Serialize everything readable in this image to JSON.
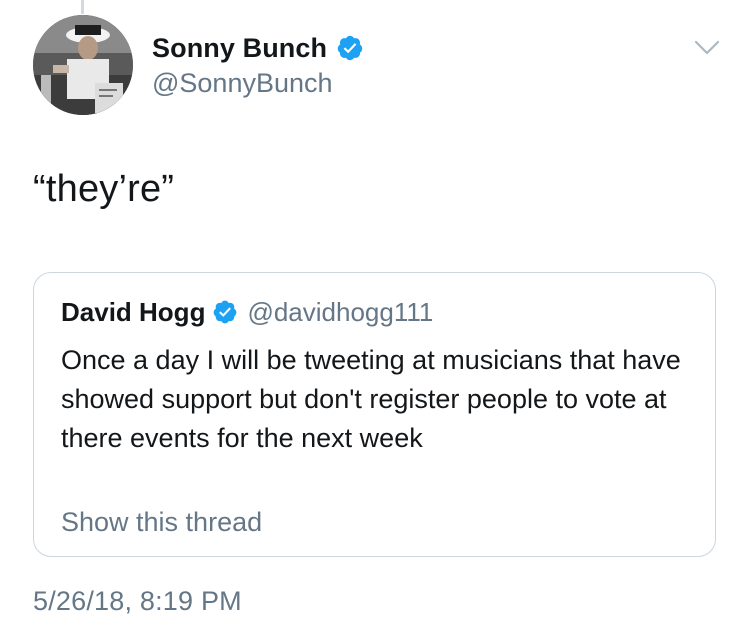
{
  "tweet": {
    "author": {
      "display_name": "Sonny Bunch",
      "handle": "@SonnyBunch",
      "verified": true
    },
    "text": "“they’re”",
    "timestamp": "5/26/18, 8:19 PM"
  },
  "quoted_tweet": {
    "author": {
      "display_name": "David Hogg",
      "handle": "@davidhogg111",
      "verified": true
    },
    "text": "Once a day I will be tweeting at musicians that have showed support but don't register people to vote at there events for the next week",
    "show_thread_label": "Show this thread"
  },
  "colors": {
    "text_primary": "#14171a",
    "text_secondary": "#657786",
    "verified_blue": "#1da1f2",
    "card_border": "#ccd6dd"
  },
  "icons": {
    "verified": "verified-badge-icon",
    "menu": "chevron-down-icon"
  }
}
